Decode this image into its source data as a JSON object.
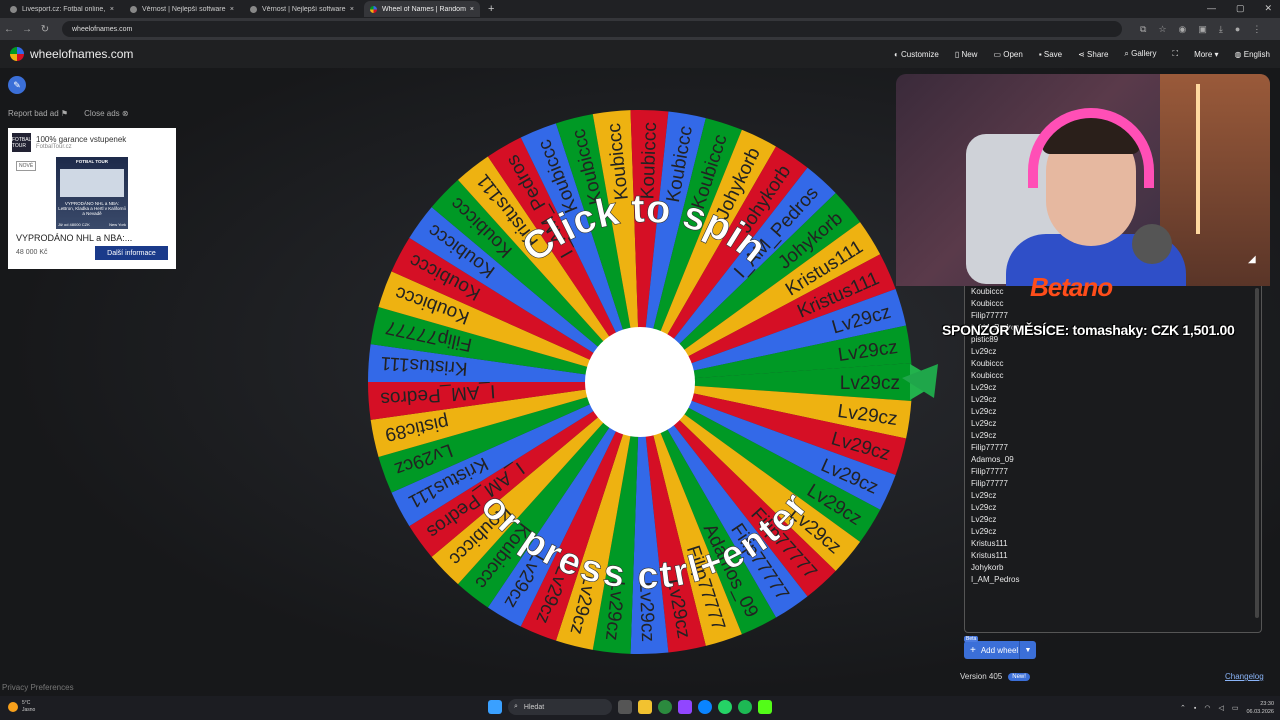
{
  "browser": {
    "tabs": [
      {
        "title": "Livesport.cz: Fotbal online, fotb",
        "active": false
      },
      {
        "title": "Věrnost | Nejlepší software pro",
        "active": false
      },
      {
        "title": "Věrnost | Nejlepší software pro",
        "active": false
      },
      {
        "title": "Wheel of Names | Random nam",
        "active": true
      }
    ],
    "url": "wheelofnames.com"
  },
  "app": {
    "site_name": "wheelofnames.com",
    "menu": [
      "Customize",
      "New",
      "Open",
      "Save",
      "Share",
      "Gallery",
      "More",
      "English"
    ]
  },
  "ad": {
    "report": "Report bad ad",
    "close": "Close ads",
    "title": "100% garance vstupenek",
    "subtitle": "FotbalTour.cz",
    "brand": "FOTBAL TOUR",
    "badge": "NOVÉ",
    "img_title": "FOTBAL TOUR",
    "img_text": "VYPRODÁNO NHL a NBA: LeBron, Kladka a Hertl v Kaliforníi a Nevadě",
    "img_price": "Již od 48000 CZK",
    "img_city": "New York",
    "headline": "VYPRODÁNO NHL a NBA:...",
    "price": "48 000 Kč",
    "cta": "Další informace"
  },
  "privacy": "Privacy Preferences",
  "wheel": {
    "top_text": "Click to spin",
    "bottom_text": "or press ctrl+enter",
    "segments": [
      "Lv29cz",
      "Lv29cz",
      "Lv29cz",
      "Lv29cz",
      "Lv29cz",
      "Lv29cz",
      "Filip77777",
      "Filip77777",
      "Adamos_09",
      "Filip77777",
      "Lv29cz",
      "Lv29cz",
      "Lv29cz",
      "Lv29cz",
      "Lv29cz",
      "Lv29cz",
      "Koubiccc",
      "Koubiccc",
      "I_AM_Pedros",
      "Kristus111",
      "Lv29cz",
      "pistic89",
      "I_AM_Pedros",
      "Kristus111",
      "Filip77777",
      "Koubiccc",
      "Koubiccc",
      "Koubiccc",
      "Koubiccc",
      "Kristus111",
      "I_AM_Pedros",
      "Koubiccc",
      "Koubiccc",
      "Koubiccc",
      "Koubiccc",
      "Koubiccc",
      "Koubiccc",
      "Johykorb",
      "Johykorb",
      "I_AM_Pedros",
      "Johykorb",
      "Kristus111",
      "Kristus111",
      "Lv29cz",
      "Lv29cz"
    ],
    "colors": [
      "#009925",
      "#eeb211",
      "#d50f25",
      "#3369e8"
    ]
  },
  "stream": {
    "sponsor": "SPONZOR MĚSÍCE: tomashaky: CZK 1,501.00",
    "betano": "Betano"
  },
  "entries": [
    "Koubiccc",
    "Koubiccc",
    "Filip77777",
    "I_AM_Pedros",
    "pistic89",
    "Lv29cz",
    "Koubiccc",
    "Koubiccc",
    "Lv29cz",
    "Lv29cz",
    "Lv29cz",
    "Lv29cz",
    "Lv29cz",
    "Filip77777",
    "Adamos_09",
    "Filip77777",
    "Filip77777",
    "Lv29cz",
    "Lv29cz",
    "Lv29cz",
    "Lv29cz",
    "Kristus111",
    "Kristus111",
    "Johykorb",
    "I_AM_Pedros"
  ],
  "controls": {
    "beta": "Beta",
    "add_wheel": "Add wheel",
    "version": "Version 405",
    "new_badge": "New!",
    "changelog": "Changelog"
  },
  "taskbar": {
    "temp": "5°C",
    "weather": "Jasno",
    "search": "Hledat",
    "time": "23:30",
    "date": "06.03.2026"
  }
}
